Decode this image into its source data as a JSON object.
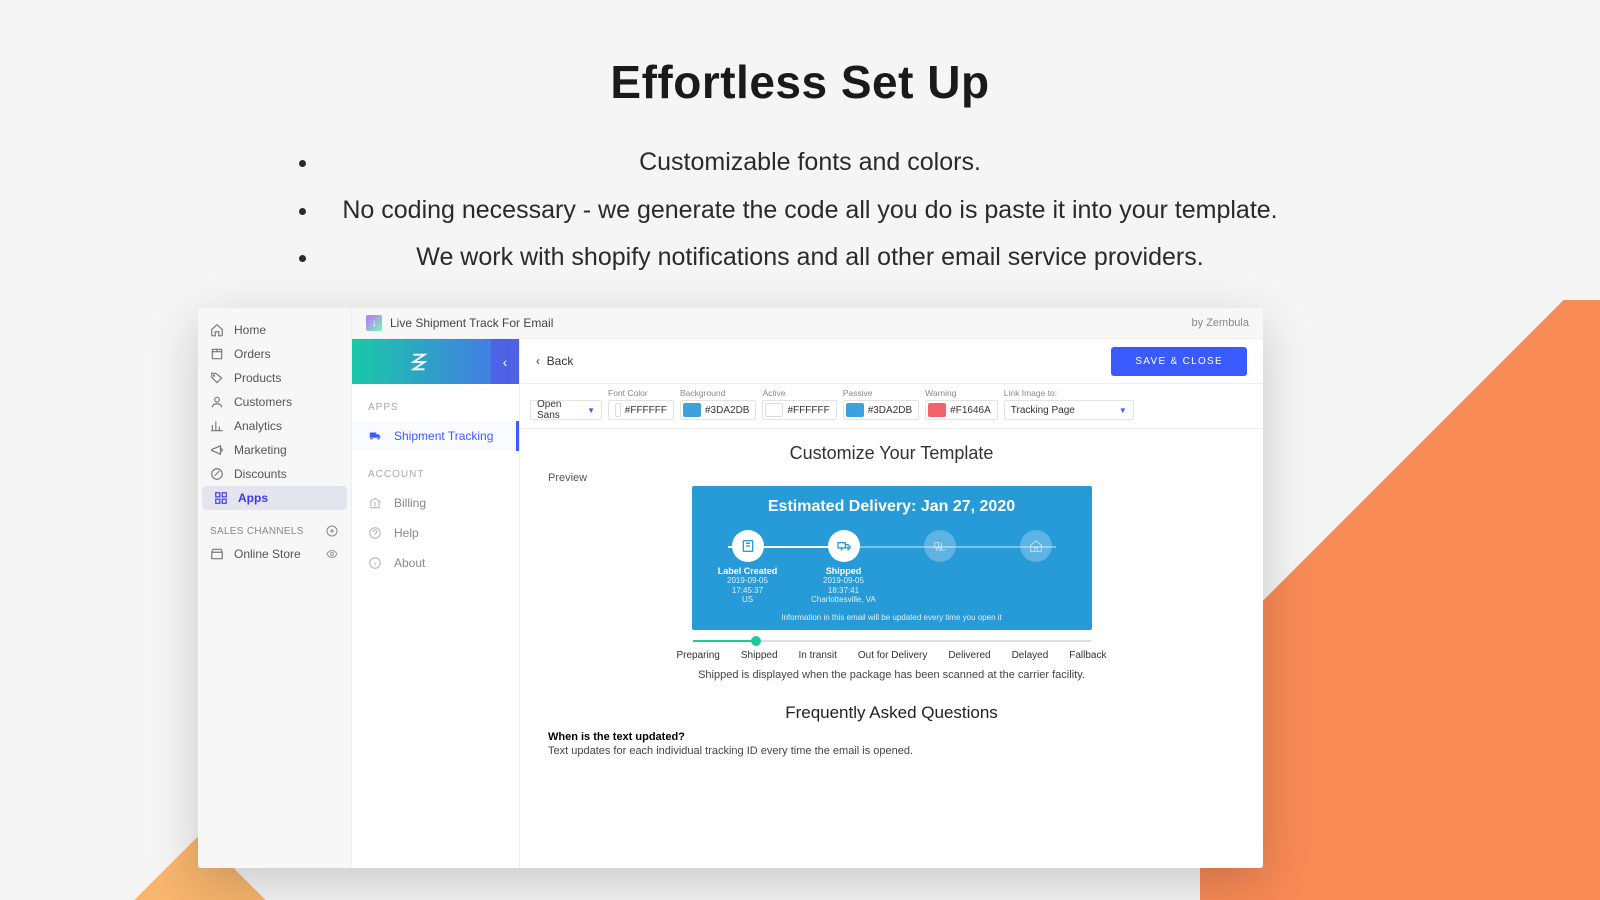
{
  "hero": {
    "title": "Effortless Set Up",
    "bullets": [
      "Customizable fonts and colors.",
      "No coding necessary - we generate the code all you do is paste it into your template.",
      "We work with shopify notifications and all other email service providers."
    ]
  },
  "shopify": {
    "nav": [
      {
        "key": "home",
        "label": "Home"
      },
      {
        "key": "orders",
        "label": "Orders"
      },
      {
        "key": "products",
        "label": "Products"
      },
      {
        "key": "customers",
        "label": "Customers"
      },
      {
        "key": "analytics",
        "label": "Analytics"
      },
      {
        "key": "marketing",
        "label": "Marketing"
      },
      {
        "key": "discounts",
        "label": "Discounts"
      },
      {
        "key": "apps",
        "label": "Apps"
      }
    ],
    "sales_channels_label": "SALES CHANNELS",
    "online_store": "Online Store"
  },
  "topbar": {
    "app_name": "Live Shipment Track For Email",
    "by": "by Zembula"
  },
  "inner_nav": {
    "apps_label": "APPS",
    "shipment_tracking": "Shipment Tracking",
    "account_label": "ACCOUNT",
    "billing": "Billing",
    "help": "Help",
    "about": "About"
  },
  "canvas": {
    "back": "Back",
    "save": "SAVE & CLOSE"
  },
  "config": {
    "font_label": "",
    "font_value": "Open Sans",
    "font_color_label": "Font Color",
    "font_color": "#FFFFFF",
    "background_label": "Background",
    "background": "#3DA2DB",
    "active_label": "Active",
    "active": "#FFFFFF",
    "passive_label": "Passive",
    "passive": "#3DA2DB",
    "warning_label": "Warning",
    "warning": "#F1646A",
    "link_label": "Link Image to:",
    "link_value": "Tracking Page"
  },
  "preview": {
    "section_title": "Customize Your Template",
    "label": "Preview",
    "eta": "Estimated Delivery: Jan 27, 2020",
    "steps": [
      {
        "name": "Label Created",
        "meta1": "2019-09-05 17:45:37",
        "meta2": "US",
        "done": true
      },
      {
        "name": "Shipped",
        "meta1": "2019-09-05 18:37:41",
        "meta2": "Charlottesville, VA",
        "done": true
      },
      {
        "name": "",
        "meta1": "",
        "meta2": "",
        "done": false
      },
      {
        "name": "",
        "meta1": "",
        "meta2": "",
        "done": false
      }
    ],
    "footer": "Information in this email will be updated every time you open it"
  },
  "states": {
    "items": [
      "Preparing",
      "Shipped",
      "In transit",
      "Out for Delivery",
      "Delivered",
      "Delayed",
      "Fallback"
    ],
    "desc": "Shipped is displayed when the package has been scanned at the carrier facility."
  },
  "faq": {
    "title": "Frequently Asked Questions",
    "q1": "When is the text updated?",
    "a1": "Text updates for each individual tracking ID every time the email is opened."
  }
}
